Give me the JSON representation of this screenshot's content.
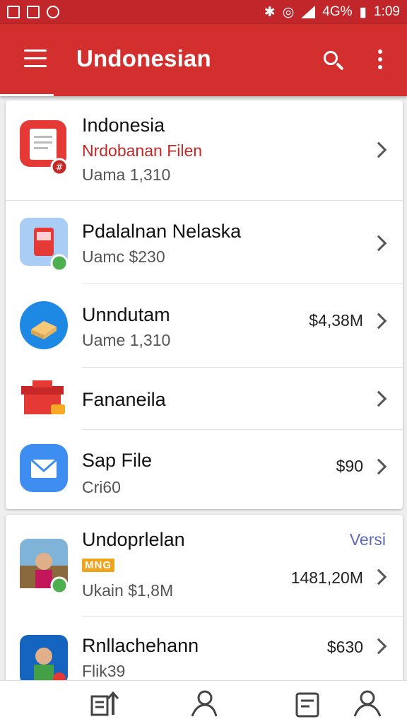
{
  "status_bar": {
    "icons": [
      "image-icon",
      "clipboard-icon",
      "location-icon"
    ],
    "right_icons": [
      "bluetooth-icon",
      "alarm-icon",
      "signal-icon",
      "wifi-icon"
    ],
    "sig_label": "4G%",
    "time": "1:09"
  },
  "app_bar": {
    "title": "Undonesian",
    "color": "#d32f2f"
  },
  "list1": [
    {
      "title": "Indonesia",
      "subtitle": "Nrdobanan Filen",
      "meta": "Uama 1,310",
      "amount": ""
    },
    {
      "title": "Pdalalnan Nelaska",
      "subtitle": "Uamc $230",
      "meta": "",
      "amount": ""
    },
    {
      "title": "Unndutam",
      "subtitle": "Uame 1,310",
      "meta": "",
      "amount": "$4,38M"
    },
    {
      "title": "Fananeila",
      "subtitle": "",
      "meta": "",
      "amount": ""
    },
    {
      "title": "Sap File",
      "subtitle": "Cri60",
      "meta": "",
      "amount": "$90"
    }
  ],
  "list2": [
    {
      "title": "Undoprlelan",
      "tag": "MNG",
      "subtitle": "Ukain $1,8M",
      "amount": "1481,20M",
      "link": "Versi"
    },
    {
      "title": "Rnllachehann",
      "subtitle": "Flik39",
      "amount": "$630"
    }
  ],
  "bottom_nav": [
    "files-upload-icon",
    "person-icon",
    "document-icon",
    "account-icon"
  ]
}
